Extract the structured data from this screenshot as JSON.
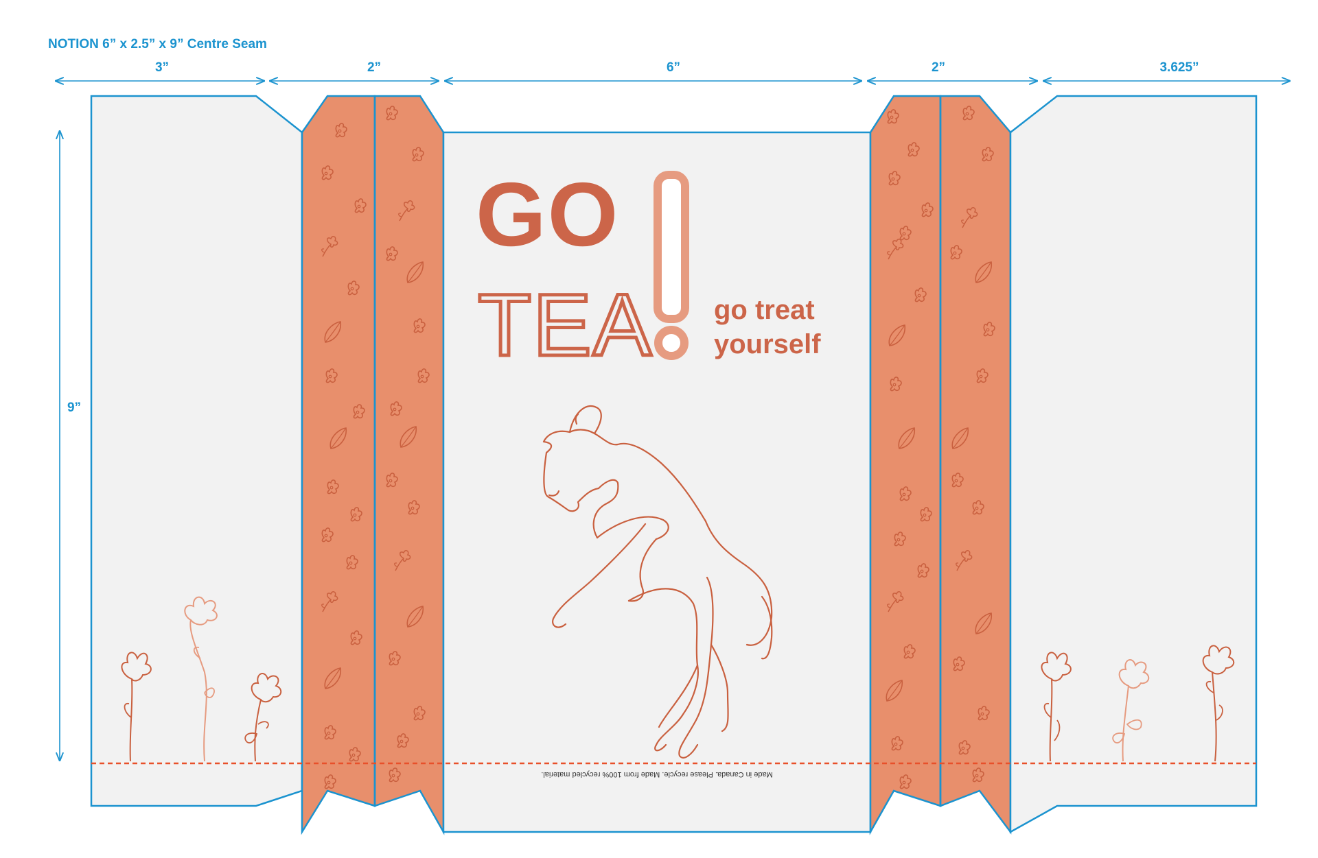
{
  "header": {
    "title": "NOTION 6” x 2.5” x 9” Centre Seam"
  },
  "dimensions": {
    "panel1_width": "3”",
    "gusset1_width": "2”",
    "front_width": "6”",
    "gusset2_width": "2”",
    "panel5_width": "3.625”",
    "height": "9”"
  },
  "front": {
    "headline_go": "GO",
    "headline_tea": "TEA",
    "tagline_line1": "go treat",
    "tagline_line2": "yourself",
    "footer_note": "Made in Canada. Please recycle. Made from 100% recycled material."
  },
  "colors": {
    "dieline": "#1b93cf",
    "panel": "#f2f2f2",
    "gusset": "#e88f6c",
    "brand": "#cc6549",
    "brand_light": "#e69b80",
    "line_art": "#c9603f",
    "fold_line": "#e8502a"
  }
}
